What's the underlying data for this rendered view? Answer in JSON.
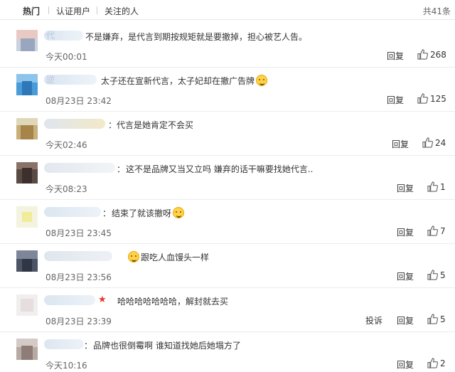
{
  "tabs": [
    {
      "label": "热门",
      "active": true
    },
    {
      "label": "认证用户",
      "active": false
    },
    {
      "label": "关注的人",
      "active": false
    }
  ],
  "total_label": "共41条",
  "comments": [
    {
      "name_fragment": "代",
      "text": "不是嫌弃，是代言到期按规矩就是要撤掉，担心被艺人告。",
      "emoji": false,
      "time": "今天00:01",
      "reply": "回复",
      "report": "",
      "likes": "268"
    },
    {
      "name_fragment": "逆",
      "text": "太子还在宣新代言，太子妃却在撤广告牌",
      "emoji": true,
      "time": "08月23日 23:42",
      "reply": "回复",
      "report": "",
      "likes": "125"
    },
    {
      "name_fragment": "",
      "text": "代言是她肯定不会买",
      "emoji": false,
      "time": "今天02:46",
      "reply": "回复",
      "report": "",
      "likes": "24"
    },
    {
      "name_fragment": "",
      "text": "这不是品牌又当又立吗 嫌弃的话干嘛要找她代言..",
      "emoji": false,
      "time": "今天08:23",
      "reply": "回复",
      "report": "",
      "likes": "1"
    },
    {
      "name_fragment": "",
      "text": "结束了就该撤呀",
      "emoji": true,
      "time": "08月23日 23:45",
      "reply": "回复",
      "report": "",
      "likes": "7"
    },
    {
      "name_fragment": "",
      "text": "跟吃人血馒头一样",
      "emoji": true,
      "time": "08月23日 23:56",
      "reply": "回复",
      "report": "",
      "likes": "5"
    },
    {
      "name_fragment": "",
      "text": "哈哈哈哈哈哈哈，解封就去买",
      "emoji": false,
      "time": "08月23日 23:39",
      "reply": "回复",
      "report": "投诉",
      "likes": "5"
    },
    {
      "name_fragment": "",
      "text": "品牌也很倒霉啊 谁知道找她后她塌方了",
      "emoji": false,
      "time": "今天10:16",
      "reply": "回复",
      "report": "",
      "likes": "2"
    }
  ],
  "colors": {
    "link": "#eb7350",
    "text": "#333333",
    "muted": "#666666",
    "divider": "#ececec",
    "star": "#e8332a"
  },
  "icons": {
    "like": "thumbs-up-icon",
    "emoji": "smiley-emoji-icon",
    "vip": "star-icon"
  }
}
